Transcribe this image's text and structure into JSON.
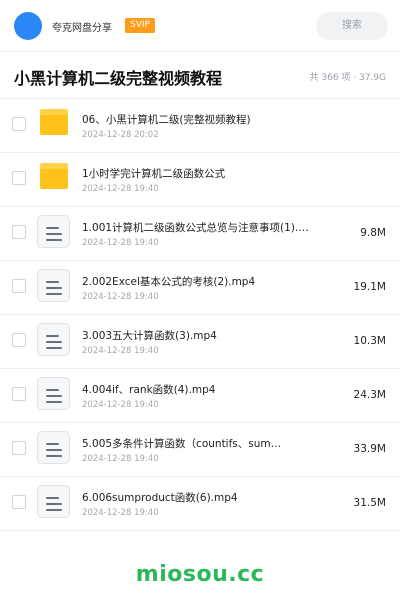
{
  "header": {
    "owner_name": "夸克网盘分享",
    "vip_label": "SVIP",
    "search_placeholder": "搜索"
  },
  "folder": {
    "title": "小黑计算机二级完整视频教程",
    "stats": "共 366 项 · 37.9G"
  },
  "files": [
    {
      "name": "06、小黑计算机二级(完整视频教程)",
      "date": "2024-12-28 20:02",
      "size": "",
      "type": "folder"
    },
    {
      "name": "1小时学完计算机二级函数公式",
      "date": "2024-12-28 19:40",
      "size": "",
      "type": "folder"
    },
    {
      "name": "1.001计算机二级函数公式总览与注意事项(1).…",
      "date": "2024-12-28 19:40",
      "size": "9.8M",
      "type": "video"
    },
    {
      "name": "2.002Excel基本公式的考核(2).mp4",
      "date": "2024-12-28 19:40",
      "size": "19.1M",
      "type": "video"
    },
    {
      "name": "3.003五大计算函数(3).mp4",
      "date": "2024-12-28 19:40",
      "size": "10.3M",
      "type": "video"
    },
    {
      "name": "4.004if、rank函数(4).mp4",
      "date": "2024-12-28 19:40",
      "size": "24.3M",
      "type": "video"
    },
    {
      "name": "5.005多条件计算函数（countifs、sum…",
      "date": "2024-12-28 19:40",
      "size": "33.9M",
      "type": "video"
    },
    {
      "name": "6.006sumproduct函数(6).mp4",
      "date": "2024-12-28 19:40",
      "size": "31.5M",
      "type": "video"
    }
  ],
  "watermark": "miosou.cc",
  "colors": {
    "accent": "#2b86f6",
    "vip": "#ff9c1a",
    "folder": "#ffc21a",
    "watermark": "#2bb75a"
  }
}
